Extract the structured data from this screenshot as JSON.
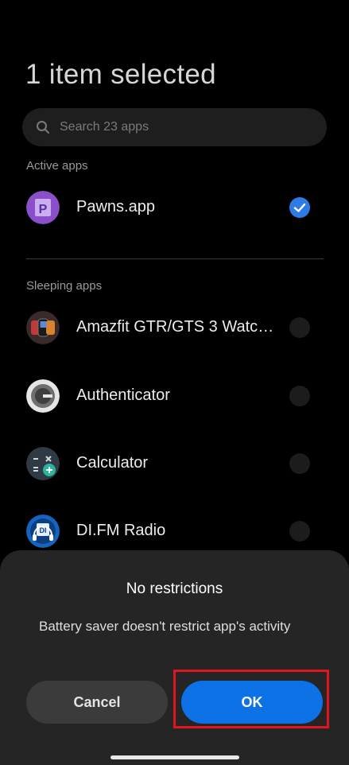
{
  "header": {
    "title": "1 item selected"
  },
  "search": {
    "placeholder": "Search 23 apps",
    "icon": "search-icon"
  },
  "sections": {
    "active": {
      "label": "Active apps",
      "apps": [
        {
          "name": "Pawns.app",
          "icon": "pawns-app-icon",
          "selected": true
        }
      ]
    },
    "sleeping": {
      "label": "Sleeping apps",
      "apps": [
        {
          "name": "Amazfit GTR/GTS 3 Watch Faces",
          "icon": "amazfit-watch-icon",
          "selected": false
        },
        {
          "name": "Authenticator",
          "icon": "authenticator-icon",
          "selected": false
        },
        {
          "name": "Calculator",
          "icon": "calculator-icon",
          "selected": false
        },
        {
          "name": "DI.FM Radio",
          "icon": "difm-radio-icon",
          "selected": false
        }
      ]
    }
  },
  "dialog": {
    "title": "No restrictions",
    "message": "Battery saver doesn't restrict app's activity",
    "cancel_label": "Cancel",
    "ok_label": "OK"
  },
  "colors": {
    "accent": "#0d72e6",
    "checkbox_selected": "#2f7be6",
    "highlight": "#e0161e",
    "sheet_background": "#252525"
  }
}
